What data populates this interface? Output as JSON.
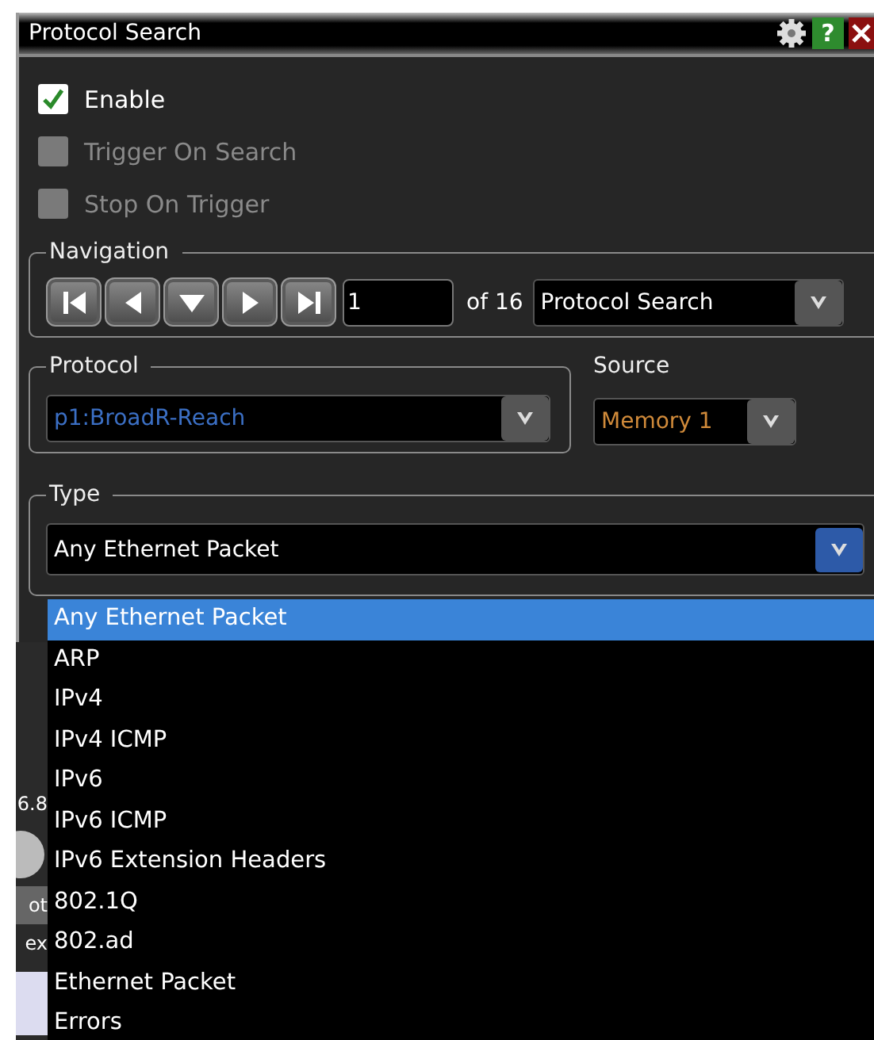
{
  "window": {
    "title": "Protocol Search",
    "help": "?"
  },
  "checks": [
    {
      "label": "Enable",
      "checked": true,
      "disabled": false
    },
    {
      "label": "Trigger On Search",
      "checked": false,
      "disabled": true
    },
    {
      "label": "Stop On Trigger",
      "checked": false,
      "disabled": true
    }
  ],
  "navigation": {
    "legend": "Navigation",
    "buttons": [
      {
        "kind": "first"
      },
      {
        "kind": "prev"
      },
      {
        "kind": "down"
      },
      {
        "kind": "next"
      },
      {
        "kind": "last"
      }
    ],
    "index": "1",
    "of_label": "of 16",
    "mode": "Protocol Search"
  },
  "protocol": {
    "legend": "Protocol",
    "value": "p1:BroadR-Reach"
  },
  "source": {
    "label": "Source",
    "value": "Memory 1"
  },
  "type": {
    "legend": "Type",
    "value": "Any Ethernet Packet",
    "expanded": true,
    "options": [
      {
        "label": "Any Ethernet Packet",
        "selected": true
      },
      {
        "label": "ARP",
        "selected": false
      },
      {
        "label": "IPv4",
        "selected": false
      },
      {
        "label": "IPv4 ICMP",
        "selected": false
      },
      {
        "label": "IPv6",
        "selected": false
      },
      {
        "label": "IPv6 ICMP",
        "selected": false
      },
      {
        "label": "IPv6 Extension Headers",
        "selected": false
      },
      {
        "label": "802.1Q",
        "selected": false
      },
      {
        "label": "802.ad",
        "selected": false
      },
      {
        "label": "Ethernet Packet",
        "selected": false
      },
      {
        "label": "Errors",
        "selected": false
      }
    ]
  },
  "background": {
    "fragments": [
      {
        "text": "6.8"
      },
      {
        "text": "ot"
      },
      {
        "text": "ex"
      }
    ]
  }
}
